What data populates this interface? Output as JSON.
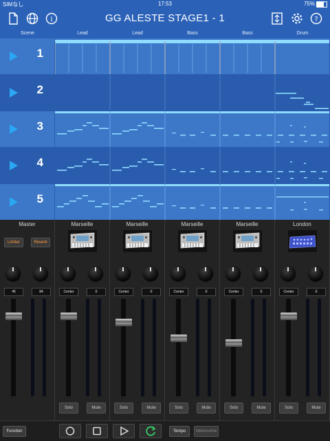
{
  "status": {
    "carrier": "SIMなし",
    "time": "17:53",
    "battery": "75%"
  },
  "nav": {
    "title": "GG ALESTE STAGE1 - 1",
    "left_icons": [
      "file-icon",
      "globe-icon",
      "info-icon"
    ],
    "right_icons": [
      "export-icon",
      "gear-icon",
      "help-icon"
    ]
  },
  "grid": {
    "headers": [
      "Scene",
      "Lead",
      "Lead",
      "Bass",
      "Bass",
      "Drum"
    ],
    "scenes": [
      "1",
      "2",
      "3",
      "4",
      "5"
    ],
    "selected_scenes": [
      "1",
      "3",
      "5"
    ]
  },
  "mixer": {
    "master": {
      "label": "Master",
      "limiter_label": "Limiter",
      "reverb_label": "Reverb",
      "values": [
        "45",
        "84"
      ],
      "fader_level": 0.85
    },
    "channels": [
      {
        "label": "Marseille",
        "pan": "Center",
        "value": "0",
        "solo": "Solo",
        "mute": "Mute",
        "fader_level": 0.85
      },
      {
        "label": "Marseille",
        "pan": "Center",
        "value": "0",
        "solo": "Solo",
        "mute": "Mute",
        "fader_level": 0.78
      },
      {
        "label": "Marseille",
        "pan": "Center",
        "value": "0",
        "solo": "Solo",
        "mute": "Mute",
        "fader_level": 0.6
      },
      {
        "label": "Marseille",
        "pan": "Center",
        "value": "0",
        "solo": "Solo",
        "mute": "Mute",
        "fader_level": 0.55
      },
      {
        "label": "London",
        "pan": "Center",
        "value": "0",
        "solo": "Solo",
        "mute": "Mute",
        "fader_level": 0.85
      }
    ]
  },
  "transport": {
    "function_label": "Function",
    "tempo_label": "Tempo",
    "metronome_label": "Metronome",
    "icons": [
      "record-icon",
      "stop-icon",
      "play-icon",
      "loop-icon"
    ]
  },
  "colors": {
    "accent": "#2b62b8",
    "selected_row": "#3c77c8",
    "play": "#2aa6f2",
    "note": "#8fdcff",
    "loop_green": "#35d16a",
    "fx_orange": "#ff9a3c"
  }
}
